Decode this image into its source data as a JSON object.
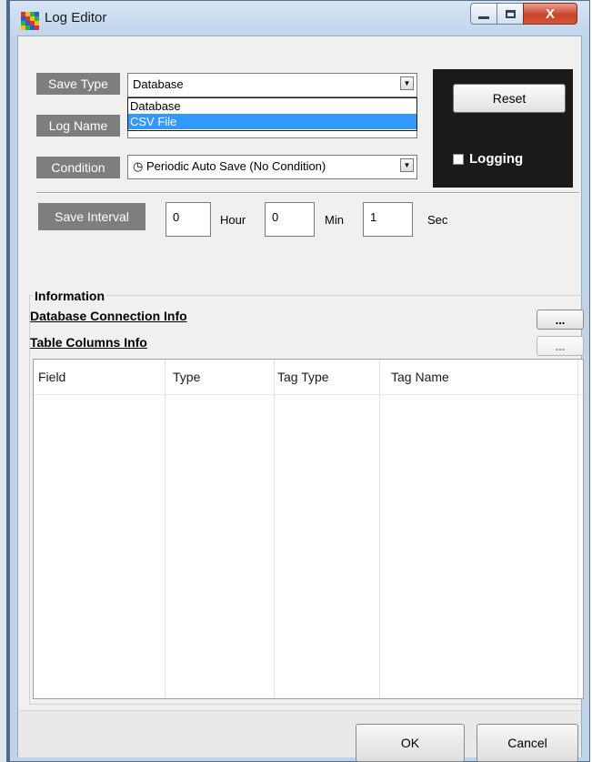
{
  "window": {
    "title": "Log Editor",
    "close_glyph": "X"
  },
  "labels": {
    "save_type": "Save Type",
    "log_name": "Log Name",
    "condition": "Condition",
    "save_interval": "Save Interval"
  },
  "save_type": {
    "selected": "Database",
    "options": [
      "Database",
      "CSV File"
    ],
    "highlighted_option": "CSV File"
  },
  "condition": {
    "selected": "Periodic Auto Save (No Condition)",
    "icon": "clock-icon",
    "icon_glyph": "◷"
  },
  "panel": {
    "reset_label": "Reset",
    "logging_label": "Logging",
    "logging_checked": false
  },
  "interval": {
    "hour": "0",
    "hour_label": "Hour",
    "min": "0",
    "min_label": "Min",
    "sec": "1",
    "sec_label": "Sec"
  },
  "information": {
    "title": "Information",
    "db_connection_link": "Database Connection Info",
    "table_columns_link": "Table Columns Info",
    "browse_label": "...",
    "columns": [
      "Field",
      "Type",
      "Tag Type",
      "Tag Name"
    ]
  },
  "footer": {
    "ok_label": "OK",
    "cancel_label": "Cancel"
  },
  "colors": {
    "label_bg": "#7e7e7e",
    "panel_bg": "#1a1a1a",
    "selection": "#3399ff",
    "close_button": "#c9442a"
  }
}
